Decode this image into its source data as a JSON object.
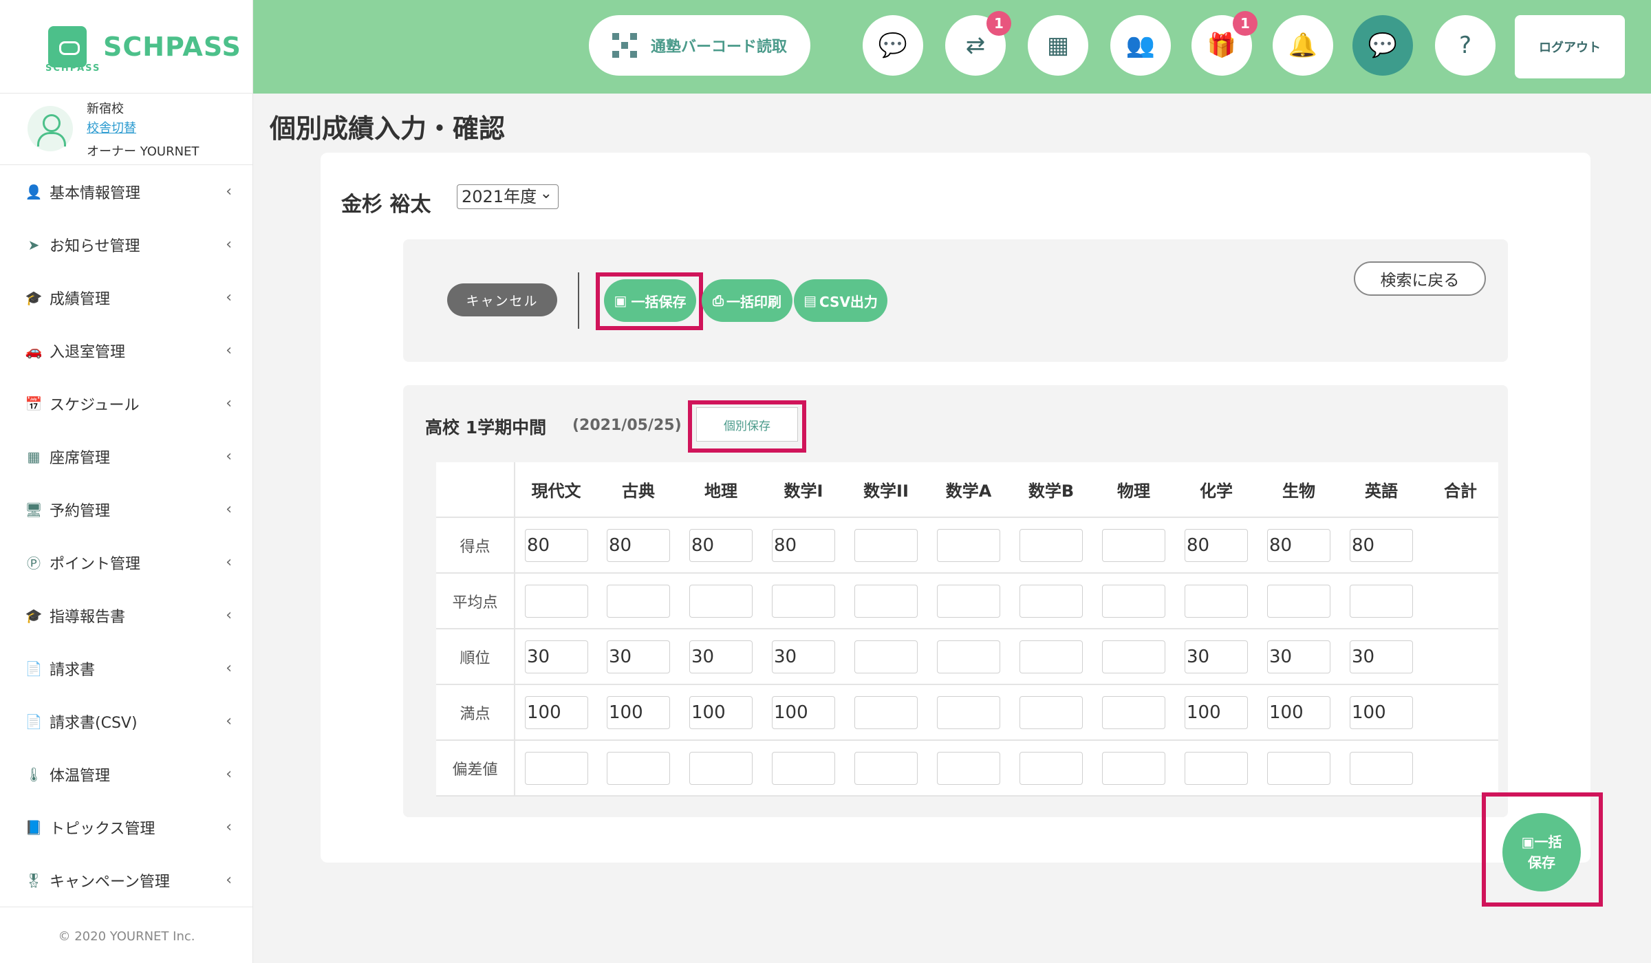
{
  "app": {
    "name": "SCHPASS",
    "sub": "SCHPASS"
  },
  "user": {
    "school": "新宿校",
    "switch_label": "校舎切替",
    "owner": "オーナー YOURNET"
  },
  "menu": [
    {
      "label": "基本情報管理",
      "icon": "person-icon"
    },
    {
      "label": "お知らせ管理",
      "icon": "paper-plane-icon"
    },
    {
      "label": "成績管理",
      "icon": "graduation-cap-icon"
    },
    {
      "label": "入退室管理",
      "icon": "car-icon"
    },
    {
      "label": "スケジュール",
      "icon": "calendar-check-icon"
    },
    {
      "label": "座席管理",
      "icon": "calendar-grid-icon"
    },
    {
      "label": "予約管理",
      "icon": "reservation-icon"
    },
    {
      "label": "ポイント管理",
      "icon": "point-icon"
    },
    {
      "label": "指導報告書",
      "icon": "graduation-cap-icon"
    },
    {
      "label": "請求書",
      "icon": "invoice-icon"
    },
    {
      "label": "請求書(CSV)",
      "icon": "invoice-icon"
    },
    {
      "label": "体温管理",
      "icon": "thermometer-icon"
    },
    {
      "label": "トピックス管理",
      "icon": "book-icon"
    },
    {
      "label": "キャンペーン管理",
      "icon": "award-icon"
    }
  ],
  "copyright": "© 2020 YOURNET Inc.",
  "header": {
    "barcode_label": "通塾バーコード読取",
    "badges": {
      "transfer": "1",
      "gift": "1"
    },
    "logout_label": "ログアウト"
  },
  "page": {
    "title": "個別成績入力・確認"
  },
  "student": {
    "name": "金杉 裕太",
    "year": "2021年度"
  },
  "toolbar": {
    "cancel_label": "キャンセル",
    "save_all_label": "一括保存",
    "print_all_label": "一括印刷",
    "csv_label": "CSV出力",
    "back_label": "検索に戻る"
  },
  "exam": {
    "title": "高校 1学期中間",
    "date": "(2021/05/25)",
    "individual_save_label": "個別保存"
  },
  "table": {
    "subjects": [
      "現代文",
      "古典",
      "地理",
      "数学I",
      "数学II",
      "数学A",
      "数学B",
      "物理",
      "化学",
      "生物",
      "英語",
      "合計"
    ],
    "rows": [
      {
        "label": "得点",
        "values": [
          "80",
          "80",
          "80",
          "80",
          "",
          "",
          "",
          "",
          "80",
          "80",
          "80"
        ]
      },
      {
        "label": "平均点",
        "values": [
          "",
          "",
          "",
          "",
          "",
          "",
          "",
          "",
          "",
          "",
          ""
        ]
      },
      {
        "label": "順位",
        "values": [
          "30",
          "30",
          "30",
          "30",
          "",
          "",
          "",
          "",
          "30",
          "30",
          "30"
        ]
      },
      {
        "label": "満点",
        "values": [
          "100",
          "100",
          "100",
          "100",
          "",
          "",
          "",
          "",
          "100",
          "100",
          "100"
        ]
      },
      {
        "label": "偏差値",
        "values": [
          "",
          "",
          "",
          "",
          "",
          "",
          "",
          "",
          "",
          "",
          ""
        ]
      }
    ]
  },
  "fab": {
    "line1": "一括",
    "line2": "保存"
  },
  "colors": {
    "brand_green": "#5cc48c",
    "header_bg": "#8cd39c",
    "highlight": "#d0145a",
    "badge": "#e8557e"
  }
}
